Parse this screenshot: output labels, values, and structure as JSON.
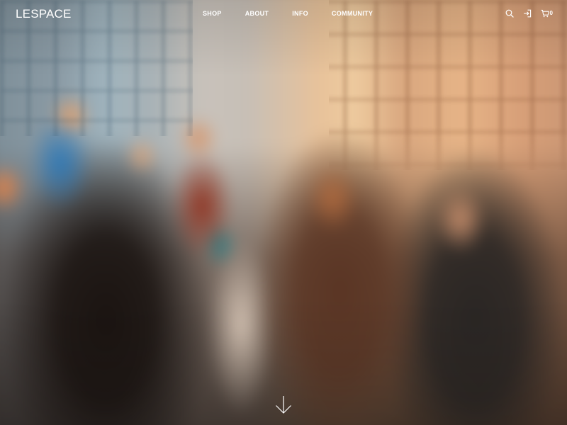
{
  "brand": {
    "logo_text": "LESPACE"
  },
  "nav": {
    "items": [
      {
        "label": "SHOP"
      },
      {
        "label": "ABOUT"
      },
      {
        "label": "INFO"
      },
      {
        "label": "COMMUNITY"
      }
    ]
  },
  "header_tools": {
    "search_icon": "search-icon",
    "login_icon": "login-icon",
    "cart_icon": "cart-icon",
    "cart_count": "0"
  },
  "hero": {
    "scroll_icon": "arrow-down-icon"
  },
  "colors": {
    "nav_text": "#ffffff"
  }
}
